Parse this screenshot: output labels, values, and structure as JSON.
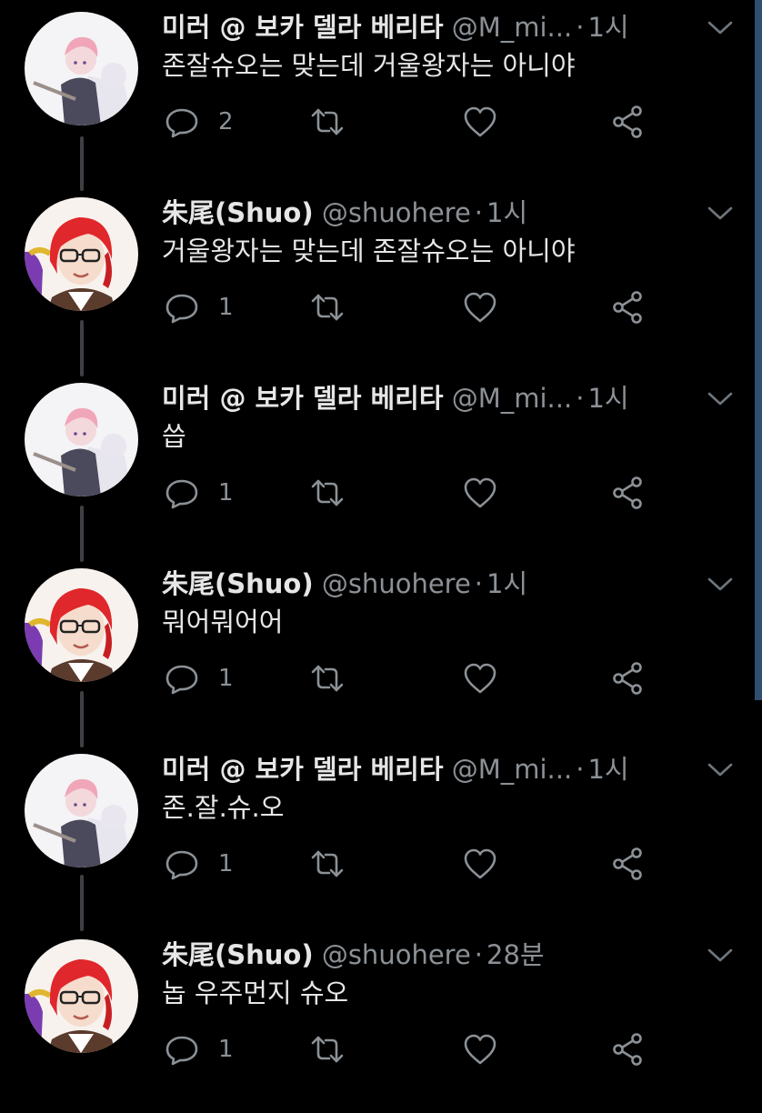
{
  "colors": {
    "background": "#000000",
    "text": "#e6e6e6",
    "muted": "#8b9196",
    "thread_line": "#3d4144"
  },
  "tweets": [
    {
      "name": "미러 @ 보카 델라 베리타",
      "handle": "@M_mi...",
      "dot": "·",
      "time": "1시",
      "text": "존잘슈오는 맞는데 거울왕자는 아니야",
      "reply_count": "2",
      "avatar": "mirror-avatar"
    },
    {
      "name": "朱尾(Shuo)",
      "handle": "@shuohere",
      "dot": "·",
      "time": "1시",
      "text": "거울왕자는 맞는데 존잘슈오는 아니야",
      "reply_count": "1",
      "avatar": "shuo-avatar"
    },
    {
      "name": "미러 @ 보카 델라 베리타",
      "handle": "@M_mi...",
      "dot": "·",
      "time": "1시",
      "text": "씁",
      "reply_count": "1",
      "avatar": "mirror-avatar"
    },
    {
      "name": "朱尾(Shuo)",
      "handle": "@shuohere",
      "dot": "·",
      "time": "1시",
      "text": "뭐어뭐어어",
      "reply_count": "1",
      "avatar": "shuo-avatar"
    },
    {
      "name": "미러 @ 보카 델라 베리타",
      "handle": "@M_mi...",
      "dot": "·",
      "time": "1시",
      "text": "존.잘.슈.오",
      "reply_count": "1",
      "avatar": "mirror-avatar"
    },
    {
      "name": "朱尾(Shuo)",
      "handle": "@shuohere",
      "dot": "·",
      "time": "28분",
      "text": "놉 우주먼지 슈오",
      "reply_count": "1",
      "avatar": "shuo-avatar"
    }
  ]
}
